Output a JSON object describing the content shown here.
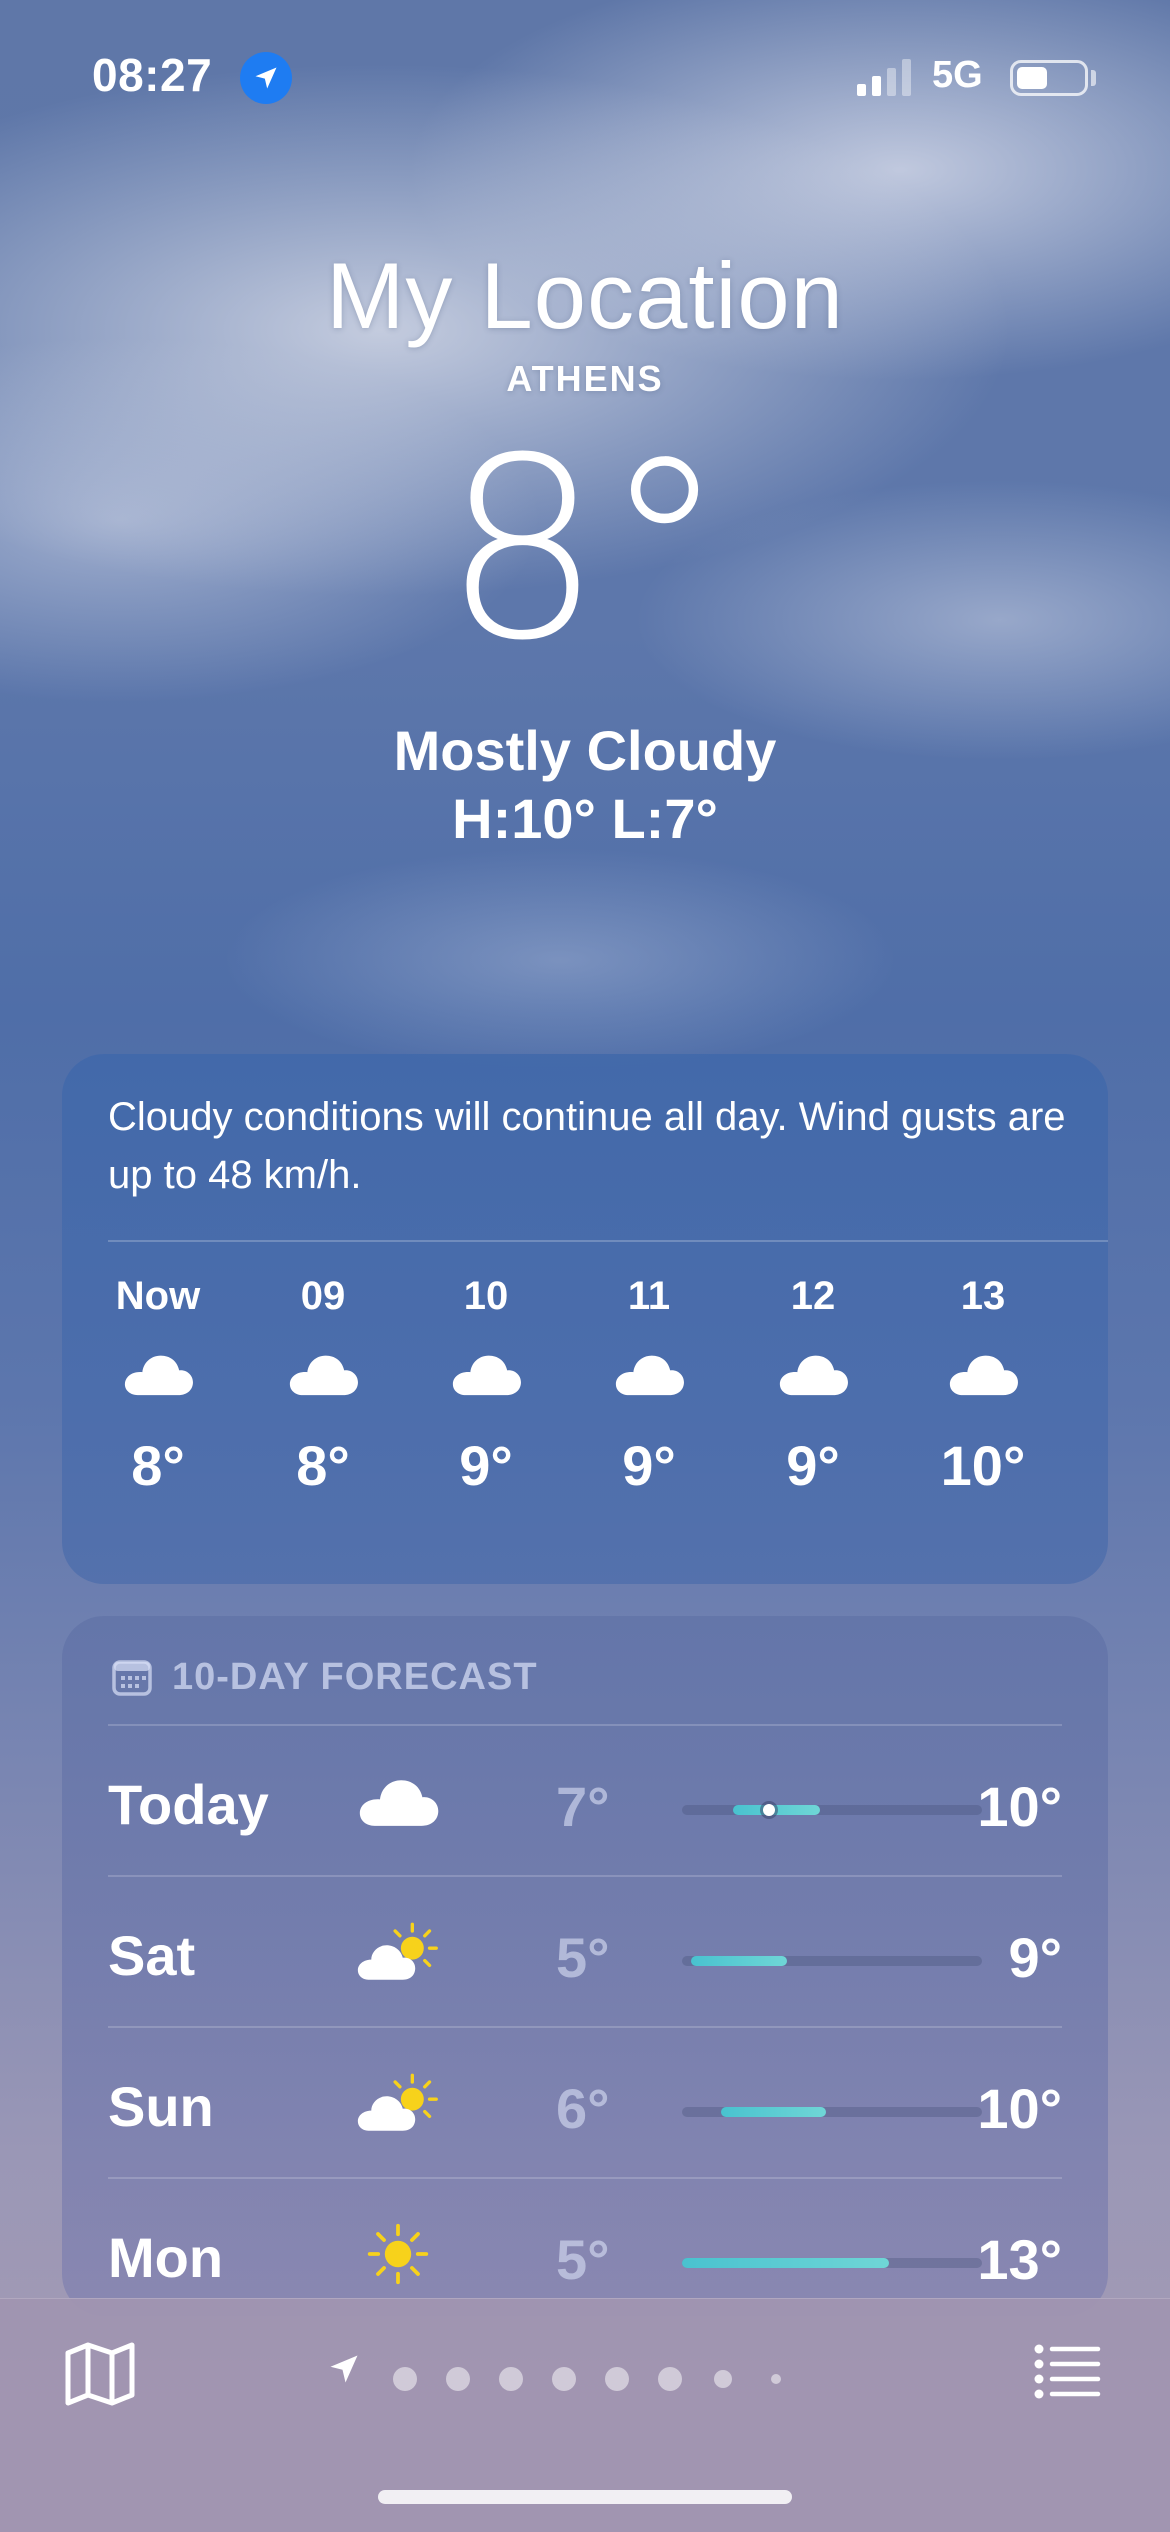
{
  "status_bar": {
    "time": "08:27",
    "network": "5G",
    "location_icon": "location-arrow-icon",
    "signal_icon": "cellular-signal-icon",
    "battery_icon": "battery-icon"
  },
  "header": {
    "location_title": "My Location",
    "city": "ATHENS",
    "temperature": "8°",
    "condition": "Mostly Cloudy",
    "high_low": "H:10°  L:7°"
  },
  "hourly": {
    "summary": "Cloudy conditions will continue all day. Wind gusts are up to 48 km/h.",
    "hours": [
      {
        "label": "Now",
        "icon": "cloud-icon",
        "temp": "8°"
      },
      {
        "label": "09",
        "icon": "cloud-icon",
        "temp": "8°"
      },
      {
        "label": "10",
        "icon": "cloud-icon",
        "temp": "9°"
      },
      {
        "label": "11",
        "icon": "cloud-icon",
        "temp": "9°"
      },
      {
        "label": "12",
        "icon": "cloud-icon",
        "temp": "9°"
      },
      {
        "label": "13",
        "icon": "cloud-icon",
        "temp": "10°"
      }
    ]
  },
  "daily": {
    "title": "10-DAY FORECAST",
    "title_icon": "calendar-icon",
    "days": [
      {
        "day": "Today",
        "icon": "cloud-icon",
        "low": "7°",
        "high": "10°",
        "bar_start": 0.17,
        "bar_end": 0.46,
        "current_marker": 0.29
      },
      {
        "day": "Sat",
        "icon": "partly-sunny-icon",
        "low": "5°",
        "high": "9°",
        "bar_start": 0.03,
        "bar_end": 0.35
      },
      {
        "day": "Sun",
        "icon": "partly-sunny-icon",
        "low": "6°",
        "high": "10°",
        "bar_start": 0.13,
        "bar_end": 0.48
      },
      {
        "day": "Mon",
        "icon": "sun-icon",
        "low": "5°",
        "high": "13°",
        "bar_start": 0.0,
        "bar_end": 0.69
      }
    ]
  },
  "bottom_bar": {
    "map_icon": "map-icon",
    "list_icon": "list-icon",
    "page_count": 9,
    "current_page": 0
  },
  "colors": {
    "accent_blue": "#1e7cf2",
    "temp_bar": "#49c2cf",
    "sun_yellow": "#f7d21b"
  }
}
